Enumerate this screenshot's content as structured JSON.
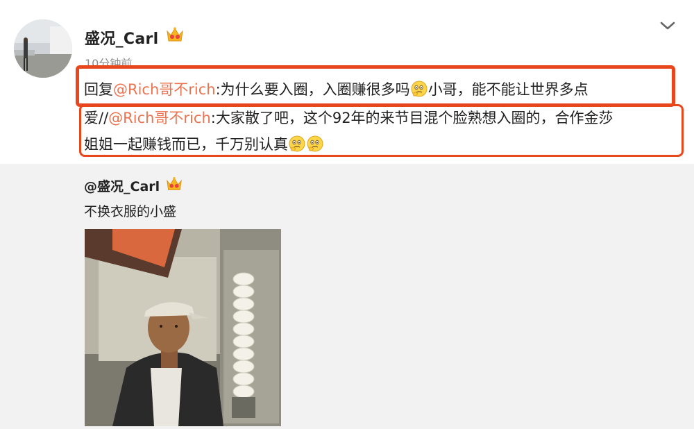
{
  "post": {
    "username": "盛况_Carl",
    "timestamp": "10分钟前",
    "crown_icon": "crown-icon",
    "more_icon": "chevron-down-icon"
  },
  "comment": {
    "line1_prefix": "回复",
    "mention1": "@Rich哥不rich",
    "line1_text": ":为什么要入圈，入圈赚很多吗",
    "line1_after_emoji": "小哥，能不能让世界多点",
    "line2_prefix": "爱//",
    "mention2": "@Rich哥不rich",
    "line2_text": ":大家散了吧，这个92年的来节目混个脸熟想入圈的，合作金莎",
    "line3_text": "姐姐一起赚钱而已，千万别认真",
    "emoji_name": "thinking-face-emoji",
    "highlight_color": "#e8471e",
    "mention_color": "#eb7350"
  },
  "repost": {
    "username": "@盛况_Carl",
    "text": "不换衣服的小盛",
    "background": "#f2f2f2"
  }
}
